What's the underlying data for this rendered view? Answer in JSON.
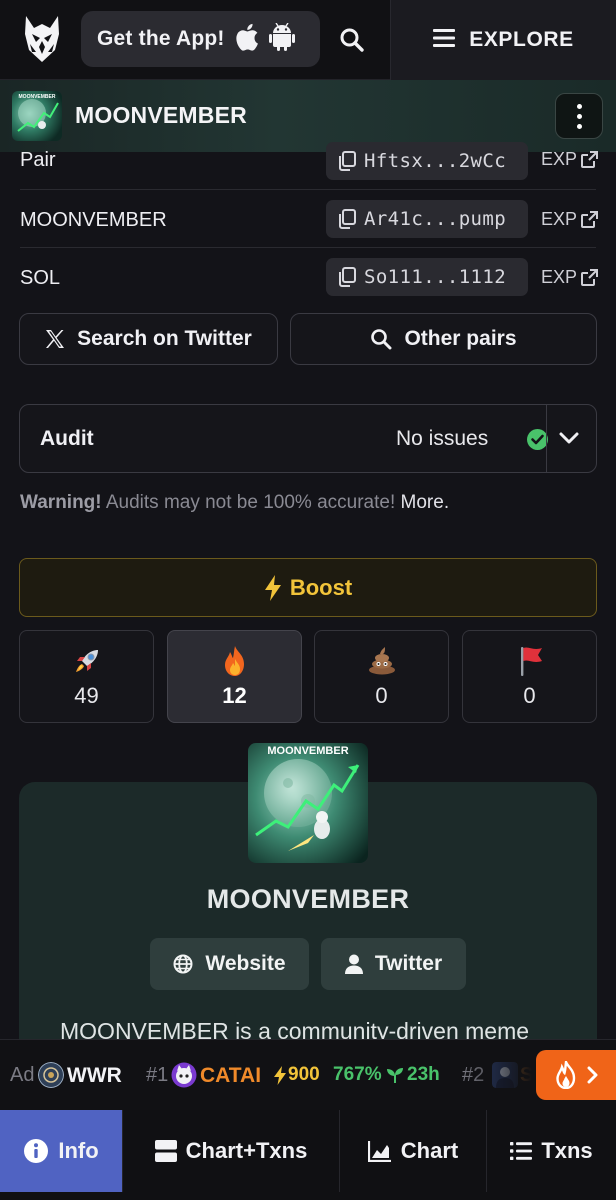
{
  "header": {
    "get_app_label": "Get the App!",
    "explore_label": "EXPLORE",
    "icons": [
      "owl-logo-icon",
      "apple-icon",
      "android-icon",
      "search-icon",
      "menu-icon"
    ]
  },
  "token": {
    "name": "MOONVEMBER",
    "thumb_caption": "MOONVEMBER"
  },
  "addresses": [
    {
      "label": "Pair",
      "value": "Hftsx...2wCc",
      "link": "EXP"
    },
    {
      "label": "MOONVEMBER",
      "value": "Ar41c...pump",
      "link": "EXP"
    },
    {
      "label": "SOL",
      "value": "So111...1112",
      "link": "EXP"
    }
  ],
  "actions": {
    "twitter_search": "Search on Twitter",
    "other_pairs": "Other pairs"
  },
  "audit": {
    "label": "Audit",
    "status": "No issues",
    "warning_strong": "Warning!",
    "warning_text": " Audits may not be 100% accurate! ",
    "warning_more": "More."
  },
  "boost": {
    "label": "Boost"
  },
  "reactions": [
    {
      "icon": "rocket-icon",
      "count": "49"
    },
    {
      "icon": "fire-icon",
      "count": "12"
    },
    {
      "icon": "poop-icon",
      "count": "0"
    },
    {
      "icon": "red-flag-icon",
      "count": "0"
    }
  ],
  "profile": {
    "image_caption": "MOONVEMBER",
    "name": "MOONVEMBER",
    "website_label": "Website",
    "twitter_label": "Twitter",
    "description": "MOONVEMBER is a community-driven meme"
  },
  "ticker": {
    "ad_label": "Ad",
    "ad_symbol": "WWR",
    "rank1": "#1",
    "symbol1": "CATAI",
    "boost1": "900",
    "change1": "767%",
    "age1": "23h",
    "rank2": "#2",
    "symbol2_partial": "S"
  },
  "nav": {
    "tabs": [
      "Info",
      "Chart+Txns",
      "Chart",
      "Txns"
    ],
    "active": "Info"
  },
  "colors": {
    "accent_nav": "#5063c2",
    "boost": "#f2c43a",
    "positive": "#49c26a",
    "hot": "#f06418",
    "card_bg": "#1c2a29"
  }
}
